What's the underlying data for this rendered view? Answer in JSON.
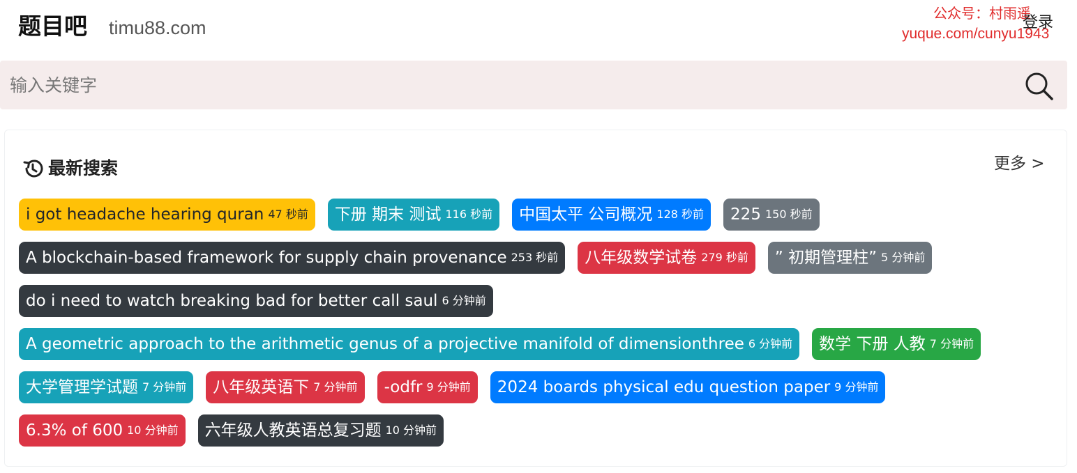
{
  "header": {
    "brand": "题目吧",
    "domain": "timu88.com",
    "login_label": "登录",
    "watermark_line1": "公众号：村雨遥",
    "watermark_line2": "yuque.com/cunyu1943"
  },
  "search": {
    "placeholder": "输入关键字",
    "icon": "search-icon"
  },
  "recent": {
    "title": "最新搜索",
    "title_icon": "history-icon",
    "more_label": "更多 >",
    "rows": [
      [
        {
          "query": "i got headache hearing quran",
          "time": "47 秒前",
          "color": "#ffc107",
          "variant": "yellow"
        },
        {
          "query": "下册 期末 测试",
          "time": "116 秒前",
          "color": "#17a2b8",
          "variant": ""
        },
        {
          "query": "中国太平 公司概况",
          "time": "128 秒前",
          "color": "#007bff",
          "variant": ""
        },
        {
          "query": "225",
          "time": "150 秒前",
          "color": "#6c757d",
          "variant": ""
        }
      ],
      [
        {
          "query": "A blockchain-based framework for supply chain provenance",
          "time": "253 秒前",
          "color": "#343a40",
          "variant": ""
        },
        {
          "query": "八年级数学试卷",
          "time": "279 秒前",
          "color": "#dc3545",
          "variant": ""
        },
        {
          "query": "” 初期管理柱”",
          "time": "5 分钟前",
          "color": "#6c757d",
          "variant": ""
        }
      ],
      [
        {
          "query": "do i need to watch breaking bad for better call saul",
          "time": "6 分钟前",
          "color": "#343a40",
          "variant": ""
        }
      ],
      [
        {
          "query": "A geometric approach to the arithmetic genus of a projective manifold of dimensionthree",
          "time": "6 分钟前",
          "color": "#17a2b8",
          "variant": ""
        },
        {
          "query": "数学 下册 人教",
          "time": "7 分钟前",
          "color": "#28a745",
          "variant": ""
        }
      ],
      [
        {
          "query": "大学管理学试题",
          "time": "7 分钟前",
          "color": "#17a2b8",
          "variant": ""
        },
        {
          "query": "八年级英语下",
          "time": "7 分钟前",
          "color": "#dc3545",
          "variant": ""
        },
        {
          "query": "-odfr",
          "time": "9 分钟前",
          "color": "#dc3545",
          "variant": ""
        },
        {
          "query": "2024 boards physical edu question paper",
          "time": "9 分钟前",
          "color": "#007bff",
          "variant": ""
        }
      ],
      [
        {
          "query": "6.3% of 600",
          "time": "10 分钟前",
          "color": "#dc3545",
          "variant": ""
        },
        {
          "query": "六年级人教英语总复习题",
          "time": "10 分钟前",
          "color": "#343a40",
          "variant": ""
        }
      ]
    ]
  }
}
